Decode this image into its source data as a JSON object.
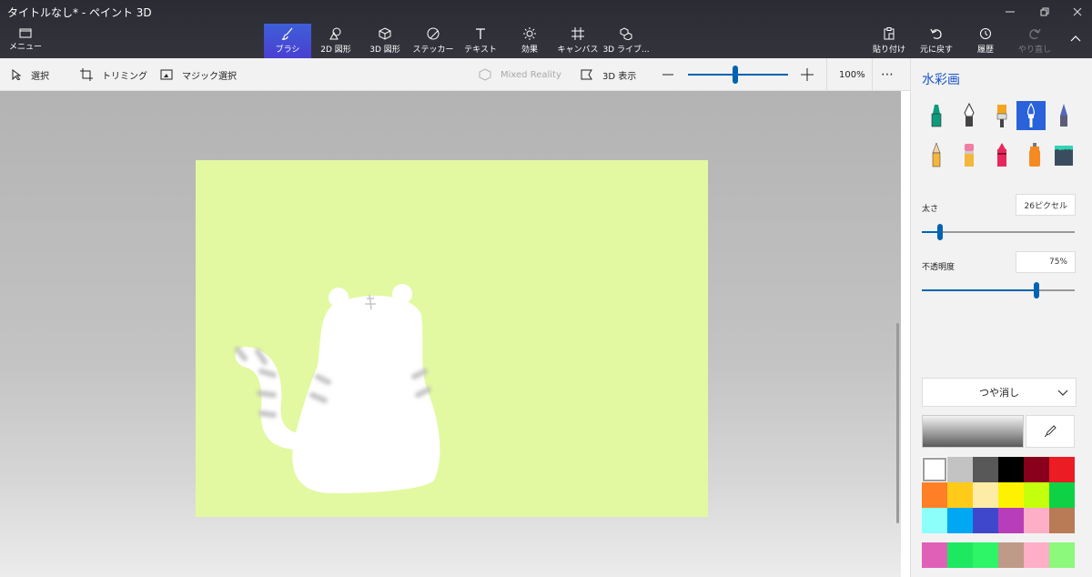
{
  "window": {
    "title": "タイトルなし* - ペイント 3D"
  },
  "menu": {
    "label": "メニュー"
  },
  "ribbon": {
    "tools": [
      {
        "label": "ブラシ",
        "icon": "brush-icon",
        "active": true
      },
      {
        "label": "2D 図形",
        "icon": "shapes-2d-icon"
      },
      {
        "label": "3D 図形",
        "icon": "cube-icon"
      },
      {
        "label": "ステッカー",
        "icon": "sticker-icon"
      },
      {
        "label": "テキスト",
        "icon": "text-icon"
      },
      {
        "label": "効果",
        "icon": "effects-icon"
      },
      {
        "label": "キャンバス",
        "icon": "canvas-icon"
      },
      {
        "label": "3D ライブ...",
        "icon": "library-3d-icon"
      }
    ],
    "actions": [
      {
        "label": "貼り付け",
        "icon": "paste-icon"
      },
      {
        "label": "元に戻す",
        "icon": "undo-icon"
      },
      {
        "label": "履歴",
        "icon": "history-icon"
      },
      {
        "label": "やり直し",
        "icon": "redo-icon",
        "disabled": true
      }
    ]
  },
  "toolbar": {
    "select": "選択",
    "crop": "トリミング",
    "magic_select": "マジック選択",
    "mixed_reality": "Mixed Reality",
    "view_3d": "3D 表示",
    "zoom_percent": "100%",
    "zoom_level": 0.47
  },
  "panel": {
    "title": "水彩画",
    "brushes": [
      "marker-icon",
      "calligraphy-pen-icon",
      "oil-brush-icon",
      "watercolor-icon",
      "pixel-pen-icon",
      "pencil-icon",
      "eraser-icon",
      "crayon-icon",
      "spray-can-icon",
      "fill-bucket-icon"
    ],
    "selected_brush": 3,
    "thickness_label": "太さ",
    "thickness_value": "26ピクセル",
    "thickness_level": 0.12,
    "opacity_label": "不透明度",
    "opacity_value": "75%",
    "opacity_level": 0.75,
    "finish": "つや消し",
    "swatches": [
      "#ffffff",
      "#c3c3c3",
      "#585858",
      "#000000",
      "#88001b",
      "#ec1c24",
      "#ff7f27",
      "#ffca18",
      "#fdeca6",
      "#fff200",
      "#c4ff0e",
      "#0ed145",
      "#8cfffb",
      "#00a8f3",
      "#3f48cc",
      "#b83dba",
      "#ffaec8",
      "#b97a56"
    ],
    "selected_swatch": 0,
    "custom_swatches": [
      "#e060b8",
      "#1ee860",
      "#2ef468",
      "#c09a88",
      "#ffaec8",
      "#8cf87c"
    ]
  },
  "colors": {
    "canvas": "#e2f9a1",
    "accent": "#0063b1"
  }
}
